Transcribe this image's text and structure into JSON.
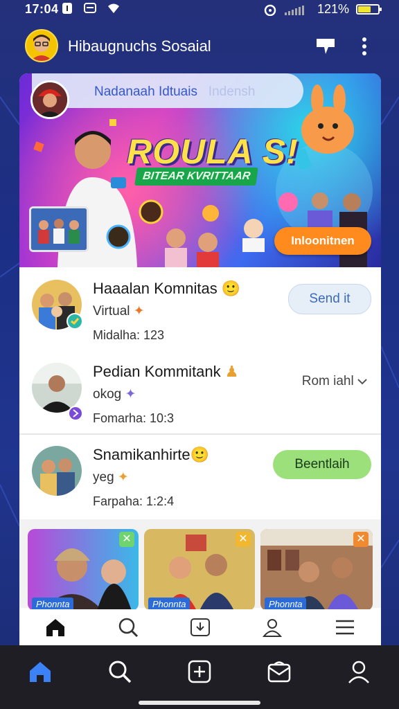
{
  "status_bar": {
    "time": "17:04",
    "battery_percent": "121%",
    "battery_level": 0.7
  },
  "header": {
    "title": "Hibaugnuchs Sosaial",
    "actions": [
      "chat-icon",
      "more-vert-icon"
    ]
  },
  "banner": {
    "search_text": "Nadanaah Idtuais",
    "search_text_faded": "Indensh",
    "headline": "ROULA S!",
    "subtitle": "BITEAR KVRITTAAR",
    "cta_label": "Inloonitnen"
  },
  "communities": [
    {
      "name": "Haaalan Komnitas",
      "sub": "Virtual",
      "meta": "Midalha:  123",
      "action": "Send it",
      "action_style": "outline-blue"
    },
    {
      "name": "Pedian Kommitank",
      "sub": "okog",
      "meta": "Fomarha:  10:3",
      "action": "Rom iahl",
      "action_style": "dropdown"
    },
    {
      "name": "Snamikanhirte",
      "sub": "yeg",
      "meta": "Farpaha:  1:2:4",
      "action": "Beentlaih",
      "action_style": "green"
    }
  ],
  "thumbnails": [
    {
      "label": "Phonnta",
      "close_color": "#6fd36f"
    },
    {
      "label": "Phonnta",
      "close_color": "#f2b730"
    },
    {
      "label": "Phonnta",
      "close_color": "#f08a30"
    }
  ],
  "inner_tabs": [
    "home-icon",
    "search-icon",
    "download-icon",
    "profile-tab-icon",
    "menu-icon"
  ],
  "bottom_nav": [
    "home-icon",
    "search-icon",
    "add-icon",
    "messages-icon",
    "profile-icon"
  ],
  "colors": {
    "accent_blue": "#3b82f6",
    "banner_cta": "#ff8a1e",
    "join_green": "#9be07a"
  }
}
